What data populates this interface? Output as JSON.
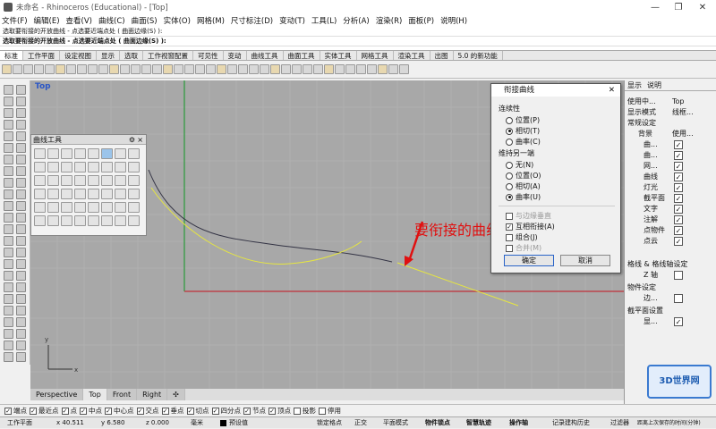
{
  "window": {
    "title": "未命名 - Rhinoceros (Educational) - [Top]",
    "minimize": "—",
    "maximize": "❐",
    "close": "✕"
  },
  "menu": [
    "文件(F)",
    "编辑(E)",
    "查看(V)",
    "曲线(C)",
    "曲面(S)",
    "实体(O)",
    "网格(M)",
    "尺寸标注(D)",
    "变动(T)",
    "工具(L)",
    "分析(A)",
    "渲染(R)",
    "面板(P)",
    "说明(H)"
  ],
  "command_history": [
    "选取要衔接的开放曲线 - 点选要近端点处 ( 曲面边缘(S) ):",
    "选取要衔接的开放曲线 - 点选要近端点处 ( 曲面边缘(S) ):"
  ],
  "tabs": [
    "标准",
    "工作平面",
    "设定视图",
    "显示",
    "选取",
    "工作视窗配置",
    "可见性",
    "变动",
    "曲线工具",
    "曲面工具",
    "实体工具",
    "网格工具",
    "渲染工具",
    "出图",
    "5.0 的新功能"
  ],
  "viewport": {
    "label": "Top",
    "axis_x_color": "#c0303a",
    "axis_y_color": "#2a9a3a"
  },
  "curve_tools_panel": {
    "title": "曲线工具"
  },
  "annotation": "要衔接的曲线",
  "dialog": {
    "title": "衔接曲线",
    "continuity_label": "连续性",
    "continuity_options": [
      "位置(P)",
      "相切(T)",
      "曲率(C)"
    ],
    "continuity_selected": 1,
    "maintain_label": "维持另一端",
    "maintain_options": [
      "无(N)",
      "位置(O)",
      "相切(A)",
      "曲率(U)"
    ],
    "maintain_selected": 3,
    "checks": [
      "与边缘垂直",
      "互相衔接(A)",
      "组合(J)",
      "合并(M)"
    ],
    "ok": "确定",
    "cancel": "取消"
  },
  "view_tabs": [
    "Perspective",
    "Top",
    "Front",
    "Right",
    "✣"
  ],
  "active_view_tab": 1,
  "osnaps": [
    [
      "端点",
      true
    ],
    [
      "最近点",
      true
    ],
    [
      "点",
      true
    ],
    [
      "中点",
      true
    ],
    [
      "中心点",
      true
    ],
    [
      "交点",
      true
    ],
    [
      "垂点",
      true
    ],
    [
      "切点",
      true
    ],
    [
      "四分点",
      true
    ],
    [
      "节点",
      true
    ],
    [
      "顶点",
      true
    ],
    [
      "投影",
      false
    ],
    [
      "停用",
      false
    ]
  ],
  "status": {
    "plane": "工作平面",
    "x": "x 40.511",
    "y": "y 6.580",
    "z": "z 0.000",
    "unit": "毫米",
    "layer": "预设值",
    "lock": "锁定格点",
    "ortho": "正交",
    "planar": "平面模式",
    "osnap": "物件锁点",
    "smarttrack": "智慧轨迹",
    "gumball": "操作轴",
    "history": "记录建构历史",
    "filter": "过滤器",
    "time": "距离上次保存的时间(分钟)"
  },
  "right_panel": {
    "tabs": [
      "显示",
      "说明"
    ],
    "use": "使用中...",
    "use_val": "Top",
    "mode": "显示模式",
    "mode_val": "线框...",
    "general": "常规设定",
    "bg": "背景",
    "bg_val": "使用...",
    "items": [
      "曲...",
      "曲...",
      "网...",
      "曲线",
      "灯光",
      "截平面",
      "文字",
      "注解",
      "点物件",
      "点云"
    ],
    "grid": "格线 & 格线轴设定",
    "zaxis": "Z 轴",
    "obj": "物件设定",
    "edge": "边...",
    "clip": "截平面设置",
    "show": "显..."
  },
  "watermark": "3D世界网"
}
